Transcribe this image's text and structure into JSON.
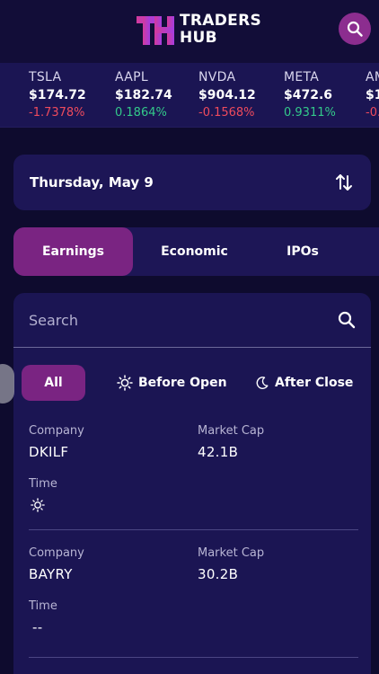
{
  "header": {
    "logo_line1": "TRADERS",
    "logo_line2": "HUB",
    "logo_mark": "TH",
    "search_icon": "search-icon",
    "accent": "#8c2d8f"
  },
  "ticker": [
    {
      "symbol": "TSLA",
      "price": "$174.72",
      "change": "-1.7378%",
      "direction": "down"
    },
    {
      "symbol": "AAPL",
      "price": "$182.74",
      "change": "0.1864%",
      "direction": "up"
    },
    {
      "symbol": "NVDA",
      "price": "$904.12",
      "change": "-0.1568%",
      "direction": "down"
    },
    {
      "symbol": "META",
      "price": "$472.6",
      "change": "0.9311%",
      "direction": "up"
    },
    {
      "symbol": "AM",
      "price": "$1",
      "change": "-0.",
      "direction": "down"
    }
  ],
  "date_selector": {
    "date": "Thursday, May 9",
    "sort_icon": "sort-arrows-icon"
  },
  "tabs": [
    {
      "label": "Earnings",
      "active": true
    },
    {
      "label": "Economic",
      "active": false
    },
    {
      "label": "IPOs",
      "active": false
    }
  ],
  "search": {
    "placeholder": "Search",
    "icon": "search-icon"
  },
  "filters": [
    {
      "label": "All",
      "active": true
    },
    {
      "label": "Before Open",
      "icon": "sun-icon"
    },
    {
      "label": "After Close",
      "icon": "moon-icon"
    }
  ],
  "earnings": [
    {
      "company_label": "Company",
      "company": "DKILF",
      "market_cap_label": "Market Cap",
      "market_cap": "42.1B",
      "time_label": "Time",
      "time": "",
      "time_icon": "sun-icon"
    },
    {
      "company_label": "Company",
      "company": "BAYRY",
      "market_cap_label": "Market Cap",
      "market_cap": "30.2B",
      "time_label": "Time",
      "time": "--"
    }
  ],
  "colors": {
    "background": "#0e0b2e",
    "card": "#1d1656",
    "active": "#7a2482",
    "negative": "#ef4b5d",
    "positive": "#33c98a"
  }
}
